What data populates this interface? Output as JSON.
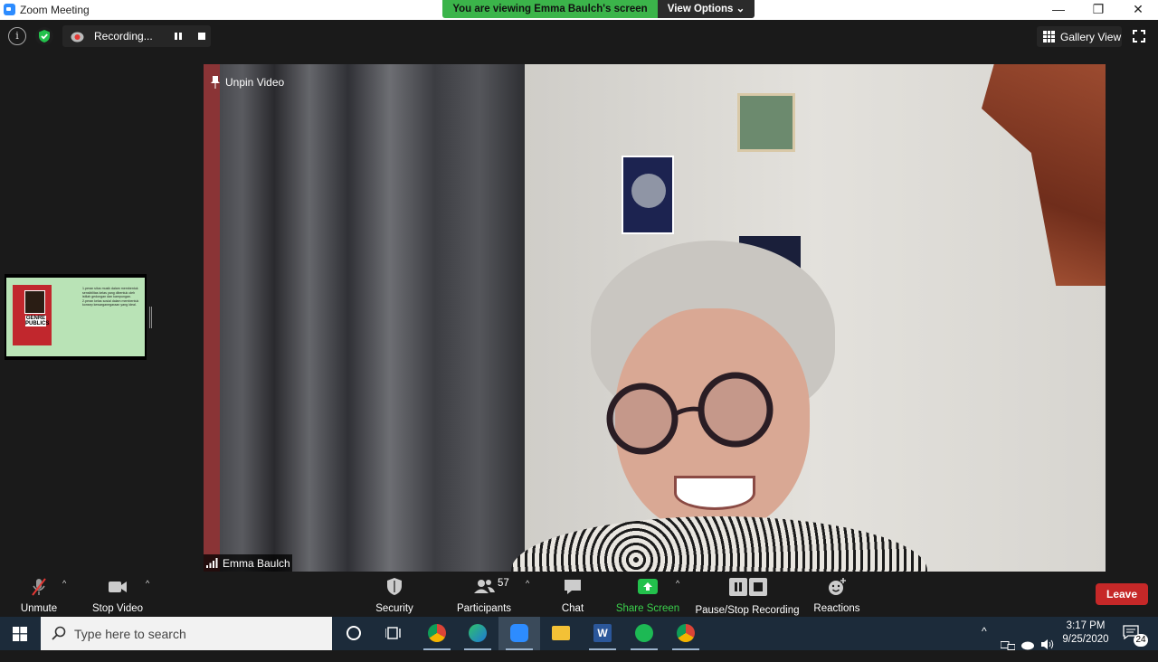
{
  "window": {
    "title": "Zoom Meeting"
  },
  "share_banner": {
    "viewing_text": "You are viewing Emma Baulch's screen",
    "view_options_label": "View Options ⌄"
  },
  "recording": {
    "label": "Recording..."
  },
  "gallery": {
    "label": "Gallery View"
  },
  "video": {
    "unpin_label": "Unpin Video",
    "participant_name": "Emma Baulch"
  },
  "thumbnail": {
    "book_title": "GENRE PUBLICS",
    "slide_text": "1.peran situs musik dalam membentuk sensibilitas kelas yang dibentuk oleh istilah gedongan dan kampungan. 2.peran kelas sosial dalam membentuk konsep kewarganegaraan yang ideal."
  },
  "toolbar": {
    "unmute": "Unmute",
    "stop_video": "Stop Video",
    "security": "Security",
    "participants": "Participants",
    "participants_count": "57",
    "chat": "Chat",
    "share_screen": "Share Screen",
    "pause_stop_recording": "Pause/Stop Recording",
    "reactions": "Reactions",
    "leave": "Leave"
  },
  "taskbar": {
    "search_placeholder": "Type here to search",
    "time": "3:17 PM",
    "date": "9/25/2020",
    "notification_count": "24"
  },
  "colors": {
    "share_green": "#3bb44a",
    "leave_red": "#c62828",
    "zoom_blue": "#2d8cff"
  }
}
